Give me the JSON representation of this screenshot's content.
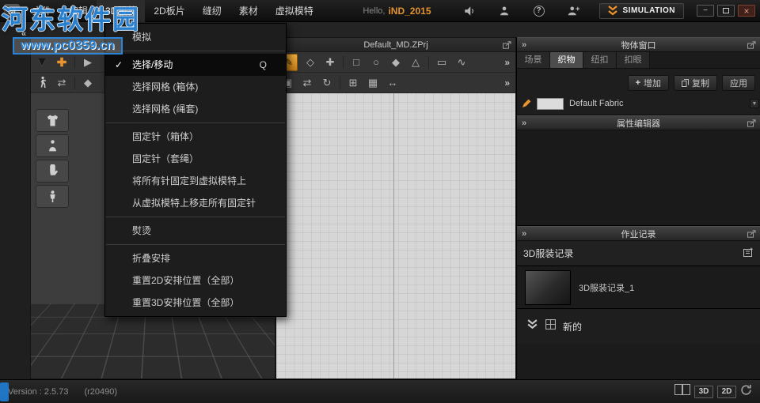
{
  "watermark": {
    "title": "河东软件园",
    "url": "www.pc0359.cn"
  },
  "titlebar": {
    "logo_text": "M",
    "menus": [
      {
        "label": "文件"
      },
      {
        "label": "编辑"
      },
      {
        "label": "3D服装"
      },
      {
        "label": "2D板片"
      },
      {
        "label": "缝纫"
      },
      {
        "label": "素材"
      },
      {
        "label": "虚拟模特"
      }
    ],
    "greeting": "Hello,",
    "username": "iND_2015",
    "simulation_button": "SIMULATION",
    "window_controls": {
      "minimize_glyph": "−",
      "close_glyph": "×"
    }
  },
  "garment_menu": {
    "items": [
      {
        "label": "模拟"
      },
      {
        "label": "选择/移动",
        "checked": true,
        "shortcut": "Q"
      },
      {
        "label": "选择网格 (箱体)"
      },
      {
        "label": "选择网格 (绳套)"
      },
      {
        "label": "固定针（箱体）"
      },
      {
        "label": "固定针（套绳）"
      },
      {
        "label": "将所有针固定到虚拟模特上"
      },
      {
        "label": "从虚拟模特上移走所有固定针"
      },
      {
        "label": "熨烫"
      },
      {
        "label": "折叠安排"
      },
      {
        "label": "重置2D安排位置（全部）"
      },
      {
        "label": "重置3D安排位置（全部）"
      }
    ]
  },
  "pattern_window": {
    "title": "Default_MD.ZPrj"
  },
  "object_window": {
    "title": "物体窗口",
    "tabs": [
      {
        "label": "场景"
      },
      {
        "label": "织物",
        "active": true
      },
      {
        "label": "纽扣"
      },
      {
        "label": "扣眼"
      }
    ],
    "buttons": [
      {
        "label": "增加"
      },
      {
        "label": "复制"
      },
      {
        "label": "应用"
      }
    ],
    "fabric_item": {
      "name": "Default Fabric"
    }
  },
  "property_editor": {
    "title": "属性编辑器"
  },
  "history_panel": {
    "title": "作业记录",
    "record_type": "3D服装记录",
    "record_name": "3D服装记录_1",
    "new_label": "新的"
  },
  "statusbar": {
    "version": "Version : 2.5.73",
    "build": "(r20490)",
    "view3d": "3D",
    "view2d": "2D"
  },
  "glyphs": {
    "check": "✓",
    "collapse": "»",
    "overflow": "»",
    "gutter_expand": "«",
    "gizmo_arrow": "▼",
    "move_cross": "✚",
    "select_arrow": "▶",
    "pan": "⇄",
    "scroll_down": "▼",
    "edit_pattern": "✎",
    "tool_row1": [
      "◇",
      "✚",
      "□",
      "○",
      "◆",
      "△",
      "▭",
      "∿"
    ],
    "tool_row2": [
      "▣",
      "⇄",
      "↻",
      "⊞",
      "▦",
      "↔"
    ],
    "help": "?"
  }
}
